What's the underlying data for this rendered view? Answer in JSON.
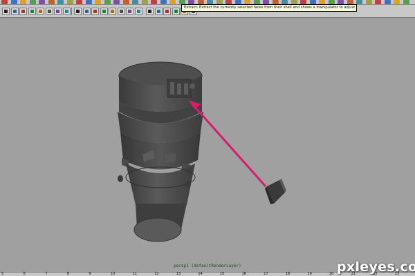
{
  "tooltip": {
    "text": "Extract: Extract the currently selected faces from their shell and shows a manipulator to adjust their offset"
  },
  "viewport": {
    "camera_label": "persp1 (defaultRenderLayer)"
  },
  "timeline": {
    "ticks": [
      "5",
      "6",
      "7",
      "8",
      "9",
      "10",
      "11",
      "12",
      "13",
      "14",
      "15",
      "16",
      "17",
      "18",
      "19",
      "20",
      "21",
      "22",
      "23"
    ]
  },
  "watermark": {
    "text": "pxleyes.com"
  },
  "colors": {
    "viewport_bg": "#a0a0a0",
    "model": "#4a4a4a",
    "arrow": "#d81b6a",
    "toolbar": "#c8c8c8",
    "tooltip_bg": "#ffffe1"
  },
  "icons": [
    "shelf-tool-icons",
    "panel-toolbar-icons",
    "arrow-annotation-icon"
  ]
}
